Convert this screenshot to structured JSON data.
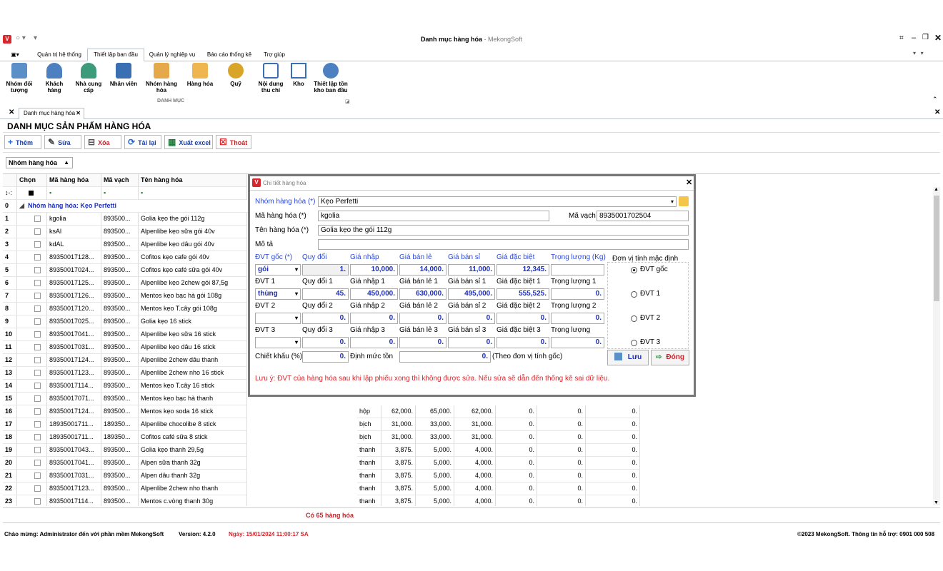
{
  "window": {
    "title": "Danh mục hàng hóa",
    "title_suffix": " - MekongSoft"
  },
  "ribbon_tabs": [
    "Quản trị hệ thống",
    "Thiết lập ban đầu",
    "Quản lý nghiệp vụ",
    "Báo cáo thống kê",
    "Trợ giúp"
  ],
  "ribbon": {
    "buttons": [
      "Nhóm đối tượng",
      "Khách hàng",
      "Nhà cung cấp",
      "Nhân viên",
      "Nhóm hàng hóa",
      "Hàng hóa",
      "Quỹ",
      "Nội dung thu chi",
      "Kho",
      "Thiết lập tồn kho ban đầu"
    ],
    "group_label": "DANH MỤC"
  },
  "doc_tab": "Danh mục hàng hóa",
  "page_title": "DANH MỤC SẢN PHẨM HÀNG HÓA",
  "toolbar": {
    "add": "Thêm",
    "edit": "Sửa",
    "delete": "Xóa",
    "reload": "Tải lại",
    "export": "Xuất excel",
    "exit": "Thoát"
  },
  "group_by": "Nhóm hàng hóa",
  "grid": {
    "headers": [
      "Chọn",
      "Mã hàng hóa",
      "Mã vạch",
      "Tên hàng hóa"
    ],
    "group_row_index": "0",
    "group_label": "Nhóm hàng hóa: Kẹo Perfetti",
    "rows": [
      [
        "1",
        "kgolia",
        "893500...",
        "Golia kẹo the gói 112g"
      ],
      [
        "2",
        "ksAl",
        "893500...",
        "Alpenlibe kẹo sữa gói 40v"
      ],
      [
        "3",
        "kdAL",
        "893500...",
        "Alpenlibe kẹo dâu gói 40v"
      ],
      [
        "4",
        "89350017128...",
        "893500...",
        "Cofitos kẹo cafe gói 40v"
      ],
      [
        "5",
        "89350017024...",
        "893500...",
        "Cofitos kẹo café sữa gói 40v"
      ],
      [
        "6",
        "89350017125...",
        "893500...",
        "Alpenlibe kẹo 2chew gói 87,5g"
      ],
      [
        "7",
        "89350017126...",
        "893500...",
        "Mentos kẹo bạc hà gói 108g"
      ],
      [
        "8",
        "89350017120...",
        "893500...",
        "Mentos kẹo T.cây gói 108g"
      ],
      [
        "9",
        "89350017025...",
        "893500...",
        "Golia kẹo 16 stick"
      ],
      [
        "10",
        "89350017041...",
        "893500...",
        "Alpenlibe kẹo sữa 16 stick"
      ],
      [
        "11",
        "89350017031...",
        "893500...",
        "Alpenlibe kẹo dâu 16 stick"
      ],
      [
        "12",
        "89350017124...",
        "893500...",
        "Alpenlibe 2chew dâu thanh"
      ],
      [
        "13",
        "89350017123...",
        "893500...",
        "Alpenlibe 2chew nho 16 stick"
      ],
      [
        "14",
        "89350017114...",
        "893500...",
        "Mentos kẹo T.cây 16 stick"
      ],
      [
        "15",
        "89350017071...",
        "893500...",
        "Mentos kẹo bạc hà thanh"
      ],
      [
        "16",
        "89350017124...",
        "893500...",
        "Mentos kẹo soda 16 stick",
        "hộp",
        "62,000.",
        "65,000.",
        "62,000.",
        "0.",
        "0.",
        "0."
      ],
      [
        "17",
        "18935001711...",
        "189350...",
        "Alpenlibe chocolibe 8 stick",
        "bịch",
        "31,000.",
        "33,000.",
        "31,000.",
        "0.",
        "0.",
        "0."
      ],
      [
        "18",
        "18935001711...",
        "189350...",
        "Cofitos café sữa 8 stick",
        "bịch",
        "31,000.",
        "33,000.",
        "31,000.",
        "0.",
        "0.",
        "0."
      ],
      [
        "19",
        "89350017043...",
        "893500...",
        "Golia kẹo thanh 29,5g",
        "thanh",
        "3,875.",
        "5,000.",
        "4,000.",
        "0.",
        "0.",
        "0."
      ],
      [
        "20",
        "89350017041...",
        "893500...",
        "Alpen sữa thanh 32g",
        "thanh",
        "3,875.",
        "5,000.",
        "4,000.",
        "0.",
        "0.",
        "0."
      ],
      [
        "21",
        "89350017031...",
        "893500...",
        "Alpen dâu thanh 32g",
        "thanh",
        "3,875.",
        "5,000.",
        "4,000.",
        "0.",
        "0.",
        "0."
      ],
      [
        "22",
        "89350017123...",
        "893500...",
        "Alpenlibe 2chew nho thanh",
        "thanh",
        "3,875.",
        "5,000.",
        "4,000.",
        "0.",
        "0.",
        "0."
      ],
      [
        "23",
        "89350017114...",
        "893500...",
        "Mentos c.vòng thanh 30g",
        "thanh",
        "3,875.",
        "5,000.",
        "4,000.",
        "0.",
        "0.",
        "0."
      ]
    ],
    "footer_count": "Có 65 hàng hóa"
  },
  "status": {
    "welcome": "Chào mừng: Administrator đến với phần mềm MekongSoft",
    "version": "Version: 4.2.0",
    "date": "Ngày: 15/01/2024 11:00:17 SA",
    "copyright": "©2023 MekongSoft. Thông tin hỗ trợ: 0901 000 508"
  },
  "dialog": {
    "title": "Chi tiết hàng hóa",
    "labels": {
      "group": "Nhóm hàng hóa (*)",
      "code": "Mã hàng hóa (*)",
      "barcode": "Mã vạch",
      "name": "Tên hàng hóa (*)",
      "desc": "Mô tả",
      "unit_base": "ĐVT gốc (*)",
      "ratio": "Quy đổi",
      "buy": "Giá nhập",
      "retail": "Giá bán lẻ",
      "wholesale": "Giá bán sỉ",
      "special": "Giá đặc biệt",
      "weight": "Trọng lượng (Kg)",
      "default_unit": "Đơn vị tính mặc định",
      "unit1": "ĐVT 1",
      "ratio1": "Quy đổi  1",
      "buy1": "Giá nhập 1",
      "retail1": "Giá bán lẻ 1",
      "wholesale1": "Giá bán sỉ 1",
      "special1": "Giá đặc biệt 1",
      "weight1": "Trọng lượng 1",
      "unit2": "ĐVT 2",
      "ratio2": "Quy đổi 2",
      "buy2": "Giá nhập 2",
      "retail2": "Giá bán lẻ 2",
      "wholesale2": "Giá bán sỉ 2",
      "special2": "Giá đặc biệt 2",
      "weight2": "Trọng lượng 2",
      "unit3": "ĐVT 3",
      "ratio3": "Quy đổi 3",
      "buy3": "Giá nhập 3",
      "retail3": "Giá bán lẻ 3",
      "wholesale3": "Giá bán sỉ 3",
      "special3": "Giá đặc biệt 3",
      "weight3": "Trọng lượng",
      "discount": "Chiết khấu (%)",
      "min_stock": "Định mức tồn",
      "min_stock_note": "(Theo đơn vị tính gốc)",
      "radio_base": "ĐVT gốc",
      "radio1": "ĐVT 1",
      "radio2": "ĐVT 2",
      "radio3": "ĐVT 3"
    },
    "values": {
      "group": "Kẹo Perfetti",
      "code": "kgolia",
      "barcode": "8935001702504",
      "name": "Golia kẹo the gói 112g",
      "desc": "",
      "unit_base": "gói",
      "ratio": "1.",
      "buy": "10,000.",
      "retail": "14,000.",
      "wholesale": "11,000.",
      "special": "12,345.",
      "weight": "",
      "unit1": "thùng",
      "ratio1": "45.",
      "buy1": "450,000.",
      "retail1": "630,000.",
      "wholesale1": "495,000.",
      "special1": "555,525.",
      "weight1": "0.",
      "unit2": "",
      "ratio2": "0.",
      "buy2": "0.",
      "retail2": "0.",
      "wholesale2": "0.",
      "special2": "0.",
      "weight2": "0.",
      "unit3": "",
      "ratio3": "0.",
      "buy3": "0.",
      "retail3": "0.",
      "wholesale3": "0.",
      "special3": "0.",
      "weight3": "0.",
      "discount": "0.",
      "min_stock": "0."
    },
    "save": "Lưu",
    "close": "Đóng",
    "note": "Lưu ý: ĐVT của hàng hóa sau khi lập phiếu xong thì không được sửa. Nếu sửa sẽ dẫn đến thống kê sai dữ liệu."
  },
  "colors": {
    "accent_blue": "#2b48d8",
    "value_blue": "#1d2fbd",
    "warning_red": "#d9262c"
  }
}
